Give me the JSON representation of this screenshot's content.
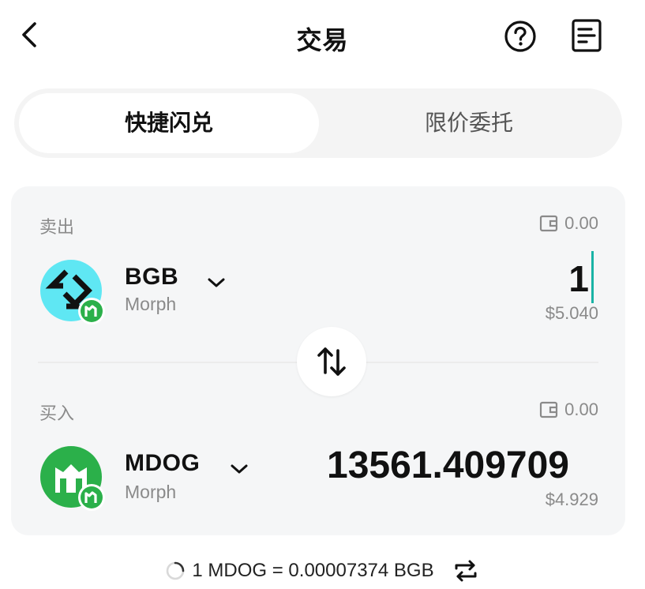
{
  "header": {
    "title": "交易"
  },
  "tabs": [
    {
      "label": "快捷闪兑",
      "active": true
    },
    {
      "label": "限价委托",
      "active": false
    }
  ],
  "sell": {
    "label": "卖出",
    "balance": "0.00",
    "token": "BGB",
    "chain": "Morph",
    "amount": "1",
    "usd": "$5.040"
  },
  "buy": {
    "label": "买入",
    "balance": "0.00",
    "token": "MDOG",
    "chain": "Morph",
    "amount": "13561.409709",
    "usd": "$4.929"
  },
  "rate": {
    "text": "1 MDOG = 0.00007374 BGB"
  },
  "colors": {
    "accent": "#19b3a6",
    "bgb_bg": "#5fe7f3",
    "mdog_bg": "#2bb04a"
  }
}
